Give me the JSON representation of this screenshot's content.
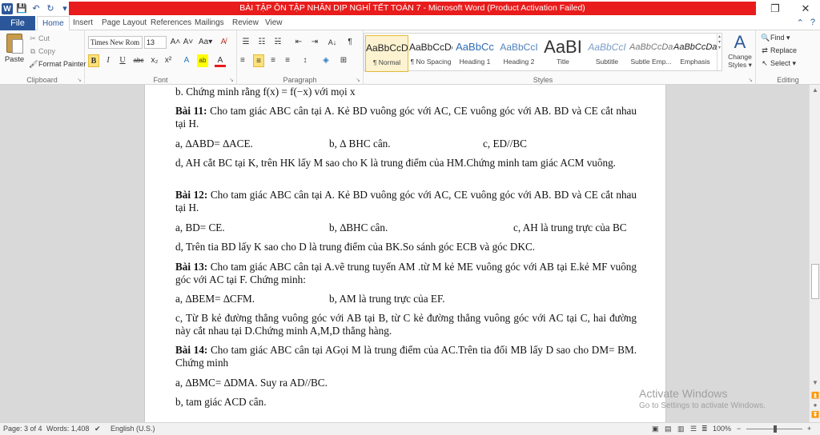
{
  "window": {
    "title": "BÀI TẬP ÔN TẬP NHÂN DỊP NGHỈ TẾT TOÁN 7 - Microsoft Word (Product Activation Failed)",
    "restore_icon": "restore-icon",
    "close_icon": "close-icon",
    "close_glyph": "✕",
    "restore_glyph": "❐",
    "accent": "#2b579a",
    "title_bg": "#e81c1c"
  },
  "quick_access": {
    "logo": "W",
    "save_glyph": "💾",
    "undo_glyph": "↶",
    "redo_glyph": "↻",
    "more_glyph": "▾"
  },
  "tabs": {
    "file": "File",
    "items": [
      "Home",
      "Insert",
      "Page Layout",
      "References",
      "Mailings",
      "Review",
      "View"
    ],
    "right": [
      "⌃",
      "?"
    ]
  },
  "ribbon": {
    "clipboard": {
      "label": "Clipboard",
      "paste": "Paste",
      "cut": "Cut",
      "copy": "Copy",
      "format_painter": "Format Painter"
    },
    "font": {
      "label": "Font",
      "name": "Times New Rom",
      "size": "13",
      "grow": "A˄",
      "shrink": "A˅",
      "change_case": "Aa▾",
      "clear": "A̸",
      "bold": "B",
      "italic": "I",
      "underline": "U",
      "strike": "abc",
      "subscript": "x₂",
      "superscript": "x²",
      "text_effects": "A",
      "highlight": "ab",
      "font_color": "A"
    },
    "paragraph": {
      "label": "Paragraph",
      "bullets": "☰",
      "numbering": "☷",
      "multilevel": "☵",
      "decrease_indent": "⇤",
      "increase_indent": "⇥",
      "sort": "A↓",
      "show_marks": "¶",
      "align_left": "≡",
      "center": "≡",
      "align_right": "≡",
      "justify": "≡",
      "line_spacing": "↕",
      "shading": "◈",
      "borders": "⊞"
    },
    "styles": {
      "label": "Styles",
      "items": [
        {
          "preview": "AaBbCcDc",
          "name": "¶ Normal"
        },
        {
          "preview": "AaBbCcDc",
          "name": "¶ No Spacing"
        },
        {
          "preview": "AaBbCc",
          "name": "Heading 1"
        },
        {
          "preview": "AaBbCcI",
          "name": "Heading 2"
        },
        {
          "preview": "AaBI",
          "name": "Title"
        },
        {
          "preview": "AaBbCcI",
          "name": "Subtitle"
        },
        {
          "preview": "AaBbCcDa",
          "name": "Subtle Emp..."
        },
        {
          "preview": "AaBbCcDa",
          "name": "Emphasis"
        }
      ],
      "change_styles": "Change Styles ▾"
    },
    "editing": {
      "label": "Editing",
      "find": "Find ▾",
      "replace": "Replace",
      "select": "Select ▾"
    }
  },
  "document": {
    "lines": [
      {
        "text": "b. Chứng minh rằng  f(x) = f(−x) với mọi x"
      },
      {
        "bold": "Bài 11:",
        "text": " Cho tam giác ABC cân tại A. Kẻ BD vuông góc với AC, CE vuông góc với AB. BD và CE cắt nhau tại H."
      },
      {
        "cols": [
          "a, ∆ABD= ∆ACE.",
          "b, ∆ BHC cân.",
          "c, ED//BC"
        ]
      },
      {
        "text": "d, AH cắt BC tại K, trên HK lấy M sao cho K là trung điểm của HM.Chứng minh tam giác ACM vuông."
      },
      {
        "bold": "Bài 12:",
        "text": " Cho tam giác ABC cân tại A. Kẻ BD vuông góc với AC, CE vuông góc với AB. BD và CE cắt nhau tại H."
      },
      {
        "cols": [
          "a, BD= CE.",
          "b, ∆BHC cân.",
          "c, AH là trung trực của BC"
        ]
      },
      {
        "text": "d, Trên tia BD lấy K sao cho D là trung điểm của BK.So sánh góc ECB và góc DKC."
      },
      {
        "bold": "Bài 13:",
        "text": " Cho tam giác ABC cân tại A.vẽ trung tuyến AM .từ M kẻ ME vuông góc với AB tại E.kẻ MF vuông góc với AC tại F. Chứng minh:"
      },
      {
        "cols": [
          "a, ∆BEM= ∆CFM.",
          "b, AM là trung trực của EF.",
          ""
        ]
      },
      {
        "text": "c, Từ B kẻ đường thẳng vuông góc với AB tại B, từ C kẻ đường thẳng vuông góc với AC tại C, hai đường này cắt nhau tại D.Chứng minh A,M,D thẳng hàng."
      },
      {
        "bold": "Bài 14:",
        "text": " Cho tam giác ABC cân tại AGọi M là trung điểm của AC.Trên tia đối MB lấy D sao cho DM= BM. Chứng minh"
      },
      {
        "text": "a, ∆BMC= ∆DMA. Suy ra AD//BC."
      },
      {
        "text": "b, tam giác ACD cân."
      }
    ]
  },
  "watermark": {
    "line1": "Activate Windows",
    "line2": "Go to Settings to activate Windows."
  },
  "statusbar": {
    "page": "Page: 3 of 4",
    "words": "Words: 1,408",
    "language": "English (U.S.)",
    "zoom": "100%",
    "zoom_out": "−",
    "zoom_in": "+"
  }
}
